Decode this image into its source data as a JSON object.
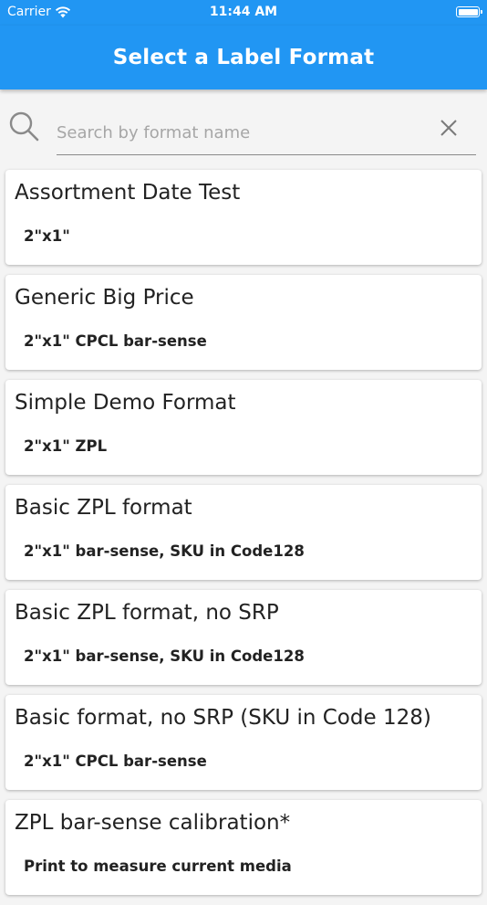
{
  "status_bar": {
    "carrier": "Carrier",
    "time": "11:44 AM",
    "wifi_icon": "wifi-icon",
    "battery_icon": "battery-icon"
  },
  "app_bar": {
    "title": "Select a Label Format",
    "color": "#2196f3"
  },
  "search": {
    "placeholder": "Search by format name",
    "value": "",
    "search_icon": "search-icon",
    "clear_icon": "close-icon"
  },
  "formats": [
    {
      "name": "Assortment Date Test",
      "description": "2\"x1\""
    },
    {
      "name": "Generic Big Price",
      "description": "2\"x1\" CPCL bar-sense"
    },
    {
      "name": "Simple Demo Format",
      "description": "2\"x1\" ZPL"
    },
    {
      "name": "Basic ZPL format",
      "description": "2\"x1\" bar-sense, SKU in Code128"
    },
    {
      "name": "Basic ZPL format, no SRP",
      "description": "2\"x1\" bar-sense, SKU in Code128"
    },
    {
      "name": "Basic format, no SRP (SKU in Code 128)",
      "description": "2\"x1\" CPCL bar-sense"
    },
    {
      "name": "ZPL bar-sense calibration*",
      "description": "Print to measure current media"
    }
  ]
}
